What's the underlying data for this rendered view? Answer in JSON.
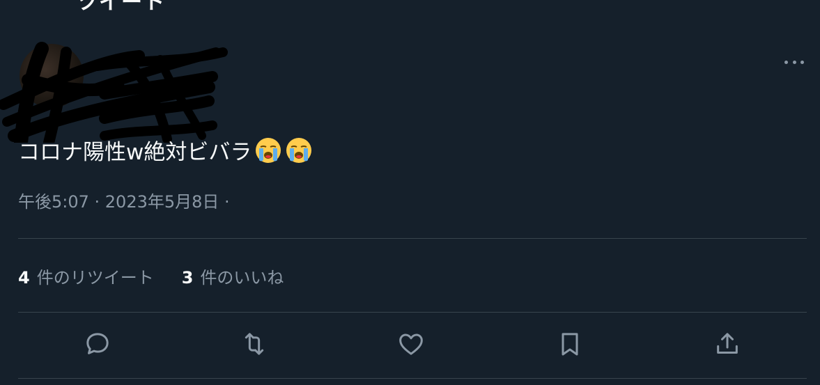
{
  "header": {
    "cropped_title": "ツイート"
  },
  "author": {
    "name": "",
    "handle": ""
  },
  "tweet": {
    "text": "コロナ陽性w絶対ビバラ",
    "emojis": [
      "loudly-crying-face",
      "loudly-crying-face"
    ],
    "timestamp": "午後5:07 · 2023年5月8日 ·"
  },
  "stats": {
    "retweets_count": "4",
    "retweets_label": "件のリツイート",
    "likes_count": "3",
    "likes_label": "件のいいね"
  },
  "actions": {
    "reply_icon": "reply-icon",
    "retweet_icon": "retweet-icon",
    "like_icon": "heart-icon",
    "bookmark_icon": "bookmark-icon",
    "share_icon": "share-icon"
  },
  "colors": {
    "background": "#15202b",
    "text_primary": "#f7f9f9",
    "text_secondary": "#8b98a5",
    "divider": "#38444d"
  }
}
